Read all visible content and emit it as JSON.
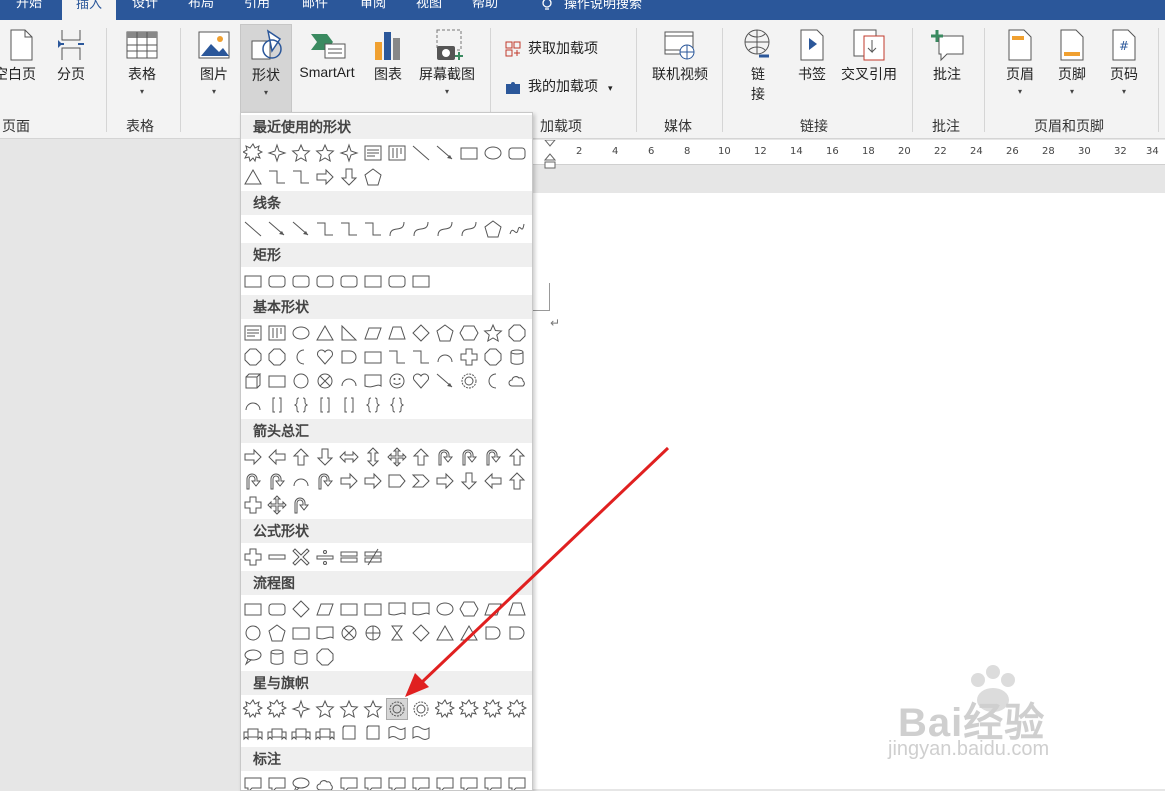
{
  "tabs": [
    "开始",
    "插入",
    "设计",
    "布局",
    "引用",
    "邮件",
    "审阅",
    "视图",
    "帮助"
  ],
  "tell_me": "操作说明搜索",
  "ribbon": {
    "pages": {
      "blank": "空白页",
      "break": "分页",
      "group": "页面"
    },
    "tables": {
      "table": "表格",
      "group": "表格"
    },
    "illustrations": {
      "picture": "图片",
      "shapes": "形状",
      "smartart": "SmartArt",
      "chart": "图表",
      "screenshot": "屏幕截图"
    },
    "addins": {
      "get": "获取加载项",
      "mine": "我的加载项",
      "group": "加载项"
    },
    "media": {
      "video": "联机视频",
      "group": "媒体"
    },
    "links": {
      "link": "链接",
      "bookmark": "书签",
      "crossref": "交叉引用",
      "group": "链接"
    },
    "comments": {
      "comment": "批注",
      "group": "批注"
    },
    "header_footer": {
      "header": "页眉",
      "footer": "页脚",
      "page_number": "页码",
      "group": "页眉和页脚"
    }
  },
  "gallery": {
    "recent": "最近使用的形状",
    "lines": "线条",
    "rectangles": "矩形",
    "basic": "基本形状",
    "arrows": "箭头总汇",
    "equation": "公式形状",
    "flowchart": "流程图",
    "stars": "星与旗帜",
    "callouts": "标注"
  },
  "ruler_labels": [
    "2",
    "4",
    "6",
    "8",
    "10",
    "12",
    "14",
    "16",
    "18",
    "20",
    "22",
    "24",
    "26",
    "28",
    "30",
    "32",
    "34"
  ],
  "watermark": {
    "brand": "Bai经验",
    "url": "jingyan.baidu.com"
  }
}
